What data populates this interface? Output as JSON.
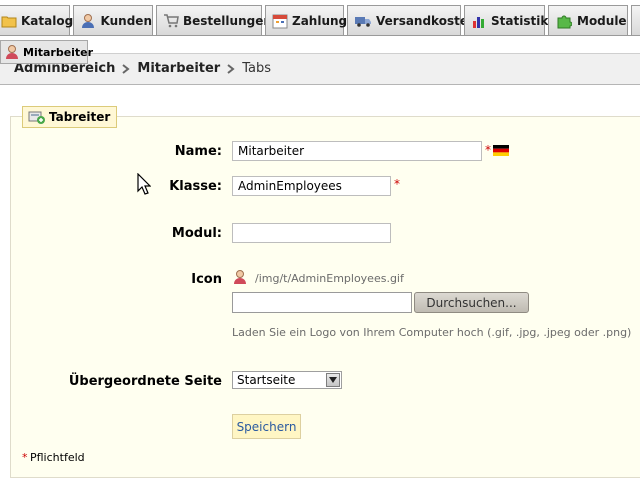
{
  "nav": {
    "tabs": [
      {
        "label": "Katalog",
        "icon": "folder-icon"
      },
      {
        "label": "Kunden",
        "icon": "customer-icon"
      },
      {
        "label": "Bestellungen",
        "icon": "cart-icon"
      },
      {
        "label": "Zahlung",
        "icon": "calendar-icon"
      },
      {
        "label": "Versandkosten",
        "icon": "truck-icon"
      },
      {
        "label": "Statistik",
        "icon": "chart-icon"
      },
      {
        "label": "Module",
        "icon": "puzzle-icon"
      }
    ]
  },
  "subnav": {
    "selected_label": "Mitarbeiter",
    "icon": "employee-icon"
  },
  "breadcrumb": {
    "items": [
      "Adminbereich",
      "Mitarbeiter"
    ],
    "current": "Tabs"
  },
  "form": {
    "legend": "Tabreiter",
    "name_label": "Name:",
    "name_value": "Mitarbeiter",
    "class_label": "Klasse:",
    "class_value": "AdminEmployees",
    "module_label": "Modul:",
    "module_value": "",
    "icon_label": "Icon",
    "icon_path": "/img/t/AdminEmployees.gif",
    "file_value": "",
    "browse_label": "Durchsuchen...",
    "upload_hint": "Laden Sie ein Logo von Ihrem Computer hoch (.gif, .jpg, .jpeg oder .png)",
    "parent_label": "Übergeordnete Seite",
    "parent_selected": "Startseite",
    "save_label": "Speichern",
    "required_marker": "*",
    "required_note": "Pflichtfeld"
  },
  "colors": {
    "required": "#cc0000",
    "panel_bg": "#fffff0",
    "save_text": "#2a5aa0"
  }
}
